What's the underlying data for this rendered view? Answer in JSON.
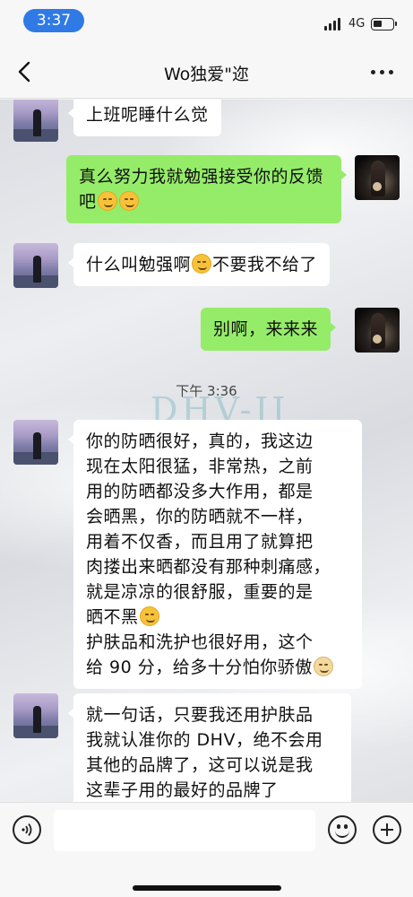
{
  "status_bar": {
    "time": "3:37",
    "network": "4G",
    "battery_level": 0.35
  },
  "nav": {
    "title": "Wo独爱\"迩",
    "back_icon": "chevron-left-icon",
    "more_icon": "more-dots-icon"
  },
  "messages": [
    {
      "side": "left",
      "text": "上班呢睡什么觉",
      "emoji": []
    },
    {
      "side": "right",
      "text": "真么努力我就勉强接受你的反馈吧",
      "emoji": [
        "thinking-face",
        "thinking-face"
      ]
    },
    {
      "side": "left",
      "text_before": "什么叫勉强啊",
      "text_after": "不要我不给了",
      "emoji": [
        "smile-face"
      ]
    },
    {
      "side": "right",
      "text": "别啊，来来来",
      "emoji": []
    },
    {
      "side": "left",
      "lines": [
        "你的防晒很好，真的，我这边",
        "现在太阳很猛，非常热，之前",
        "用的防晒都没多大作用，都是",
        "会晒黑，你的防晒就不一样，",
        "用着不仅香，而且用了就算把",
        "肉搂出来晒都没有那种刺痛感，",
        "就是凉凉的很舒服，重要的是",
        "晒不黑",
        "护肤品和洗护也很好用，这个",
        "给 90 分，给多十分怕你骄傲"
      ],
      "emoji": [
        "laughing-face",
        "dog-face"
      ]
    },
    {
      "side": "left",
      "lines": [
        "就一句话，只要我还用护肤品",
        "我就认准你的 DHV，绝不会用",
        "其他的品牌了，这可以说是我",
        "这辈子用的最好的品牌了"
      ],
      "emoji": []
    }
  ],
  "timestamp": "下午 3:36",
  "watermark": "DHV-II",
  "input": {
    "placeholder": "",
    "voice_icon": "voice-icon",
    "emoji_icon": "emoji-icon",
    "plus_icon": "plus-icon"
  },
  "colors": {
    "sent_bubble": "#95ec69",
    "received_bubble": "#ffffff",
    "time_pill": "#2f7ae5"
  }
}
